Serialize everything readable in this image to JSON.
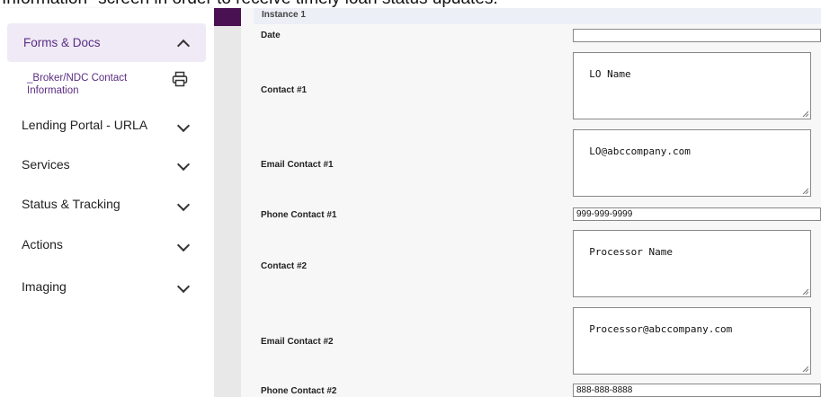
{
  "banner": {
    "text": "Information\" screen in order to receive timely loan status updates."
  },
  "sidebar": {
    "active_section": "Forms & Docs",
    "sub_item": "_Broker/NDC Contact Information",
    "items": [
      {
        "label": "Lending Portal - URLA"
      },
      {
        "label": "Services"
      },
      {
        "label": "Status & Tracking"
      },
      {
        "label": "Actions"
      },
      {
        "label": "Imaging"
      }
    ]
  },
  "form": {
    "instance_label": "Instance 1",
    "fields": {
      "date": {
        "label": "Date",
        "value": ""
      },
      "contact1": {
        "label": "Contact #1",
        "value": "LO Name"
      },
      "email1": {
        "label": "Email Contact #1",
        "value": "LO@abccompany.com"
      },
      "phone1": {
        "label": "Phone Contact #1",
        "value": "999-999-9999"
      },
      "contact2": {
        "label": "Contact #2",
        "value": "Processor Name"
      },
      "email2": {
        "label": "Email Contact #2",
        "value": "Processor@abccompany.com"
      },
      "phone2": {
        "label": "Phone Contact #2",
        "value": "888-888-8888"
      }
    }
  },
  "icons": {
    "collapse": "chevron-up-icon",
    "expand": "chevron-down-icon",
    "print": "printer-icon"
  },
  "colors": {
    "accent_purple": "#5a2d82",
    "active_bg": "#efeaf6",
    "dark_purple": "#4a1152"
  }
}
